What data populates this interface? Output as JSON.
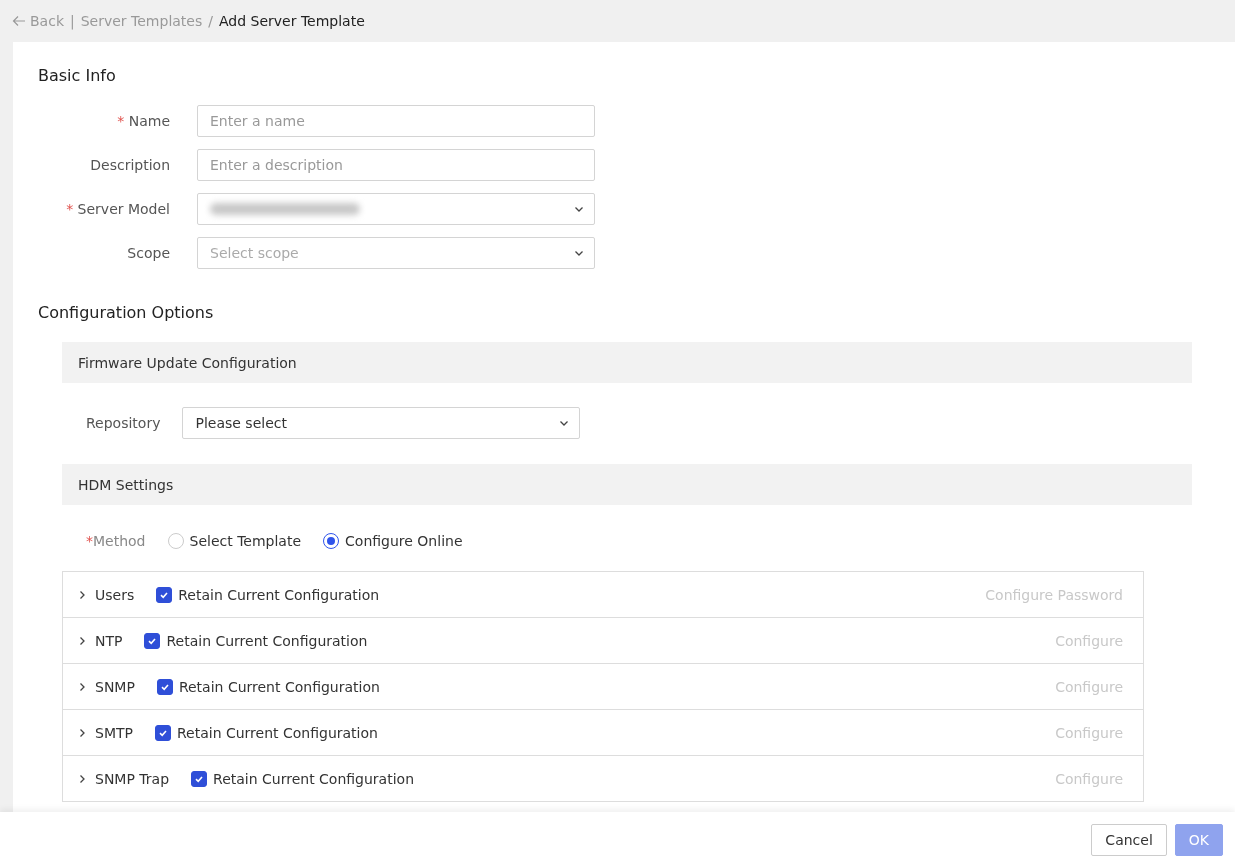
{
  "breadcrumb": {
    "back": "Back",
    "divider": "|",
    "parent": "Server Templates",
    "separator": "/",
    "current": "Add Server Template"
  },
  "basic_info": {
    "title": "Basic Info",
    "fields": [
      {
        "kind": "input",
        "label": "Name",
        "required_mark": "*",
        "placeholder": "Enter a name"
      },
      {
        "kind": "input",
        "label": "Description",
        "placeholder": "Enter a description"
      },
      {
        "kind": "masked_select",
        "label": "Server Model",
        "required_mark": "*"
      },
      {
        "kind": "select",
        "label": "Scope",
        "placeholder": "Select scope"
      }
    ]
  },
  "configuration": {
    "title": "Configuration Options",
    "firmware": {
      "title": "Firmware Update Configuration",
      "repository": {
        "label": "Repository",
        "value": "Please select"
      }
    },
    "hdm": {
      "title": "HDM Settings",
      "method": {
        "label": "Method",
        "required_mark": "*",
        "options": [
          {
            "label": "Select Template",
            "selected": false
          },
          {
            "label": "Configure Online",
            "selected": true
          }
        ]
      },
      "rows": [
        {
          "name": "Users",
          "expanded": false,
          "retain_label": "Retain Current Configuration",
          "checked": true,
          "action": "Configure Password",
          "disabled": true
        },
        {
          "name": "NTP",
          "expanded": false,
          "retain_label": "Retain Current Configuration",
          "checked": true,
          "action": "Configure",
          "disabled": true
        },
        {
          "name": "SNMP",
          "expanded": false,
          "retain_label": "Retain Current Configuration",
          "checked": true,
          "action": "Configure",
          "disabled": true
        },
        {
          "name": "SMTP",
          "expanded": false,
          "retain_label": "Retain Current Configuration",
          "checked": true,
          "action": "Configure",
          "disabled": true
        },
        {
          "name": "SNMP Trap",
          "expanded": false,
          "retain_label": "Retain Current Configuration",
          "checked": true,
          "action": "Configure",
          "disabled": true
        }
      ]
    }
  },
  "footer": {
    "buttons": [
      {
        "label": "Cancel",
        "kind": "secondary"
      },
      {
        "label": "OK",
        "kind": "primary",
        "disabled": true
      }
    ]
  }
}
